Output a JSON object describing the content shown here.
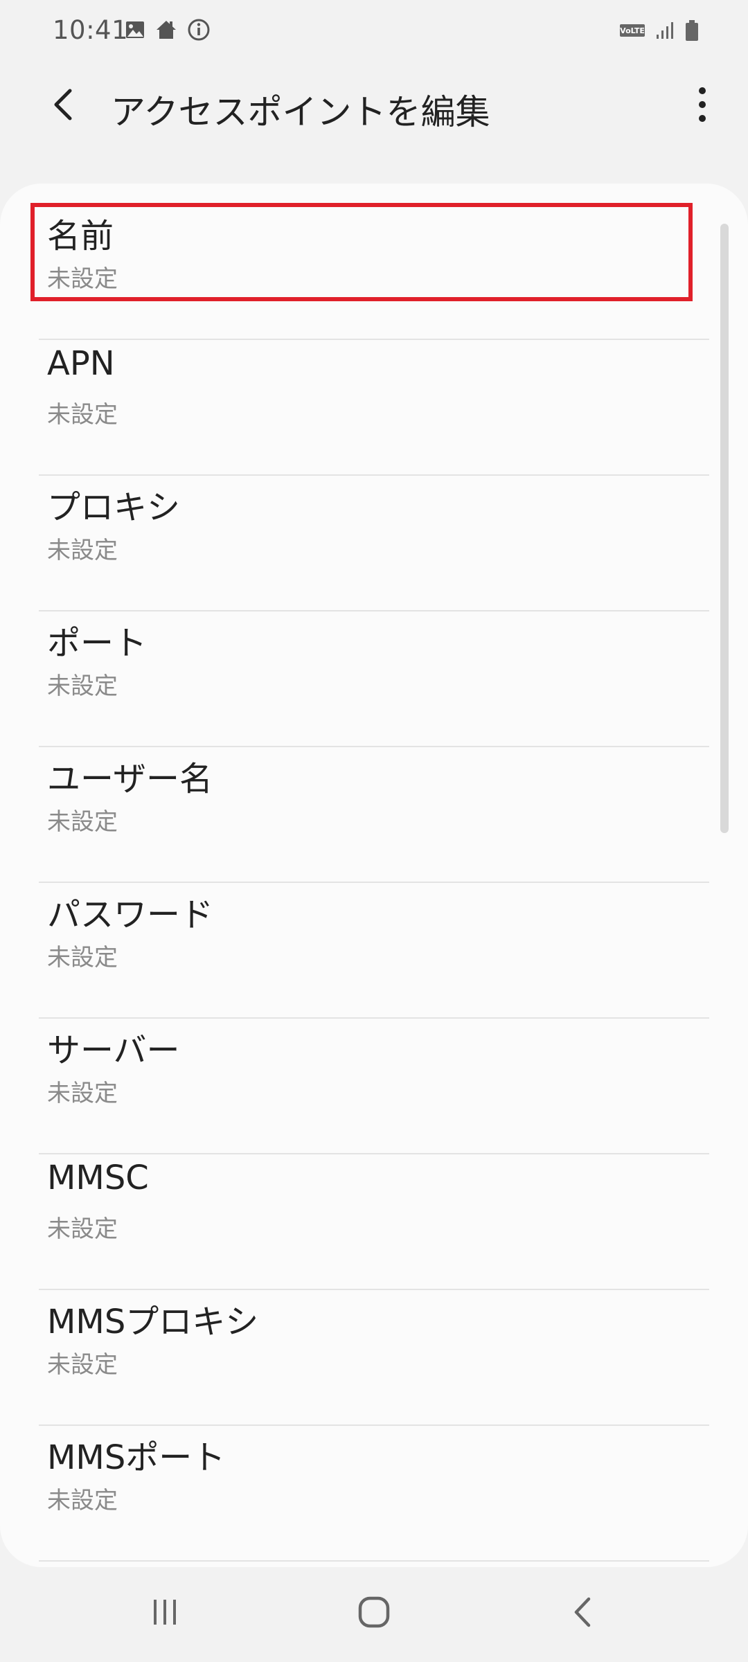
{
  "status_bar": {
    "time": "10:41",
    "left_icons": [
      "image-icon",
      "home-icon",
      "info-icon"
    ],
    "right_icons": [
      "volte-icon",
      "signal-icon",
      "battery-icon"
    ],
    "volte_label": "VoLTE"
  },
  "app_bar": {
    "title": "アクセスポイントを編集",
    "back_icon": "chevron-left-icon",
    "more_icon": "more-vertical-icon"
  },
  "items": [
    {
      "title": "名前",
      "summary": "未設定",
      "highlighted": true
    },
    {
      "title": "APN",
      "summary": "未設定"
    },
    {
      "title": "プロキシ",
      "summary": "未設定"
    },
    {
      "title": "ポート",
      "summary": "未設定"
    },
    {
      "title": "ユーザー名",
      "summary": "未設定"
    },
    {
      "title": "パスワード",
      "summary": "未設定"
    },
    {
      "title": "サーバー",
      "summary": "未設定"
    },
    {
      "title": "MMSC",
      "summary": "未設定"
    },
    {
      "title": "MMSプロキシ",
      "summary": "未設定"
    },
    {
      "title": "MMSポート",
      "summary": "未設定"
    }
  ],
  "colors": {
    "highlight_border": "#e0202a",
    "background": "#f2f2f2",
    "card": "#fbfbfb",
    "summary_text": "#8a8a8a"
  },
  "nav_bar": {
    "icons": [
      "recent-apps-icon",
      "home-button-icon",
      "back-nav-icon"
    ]
  }
}
